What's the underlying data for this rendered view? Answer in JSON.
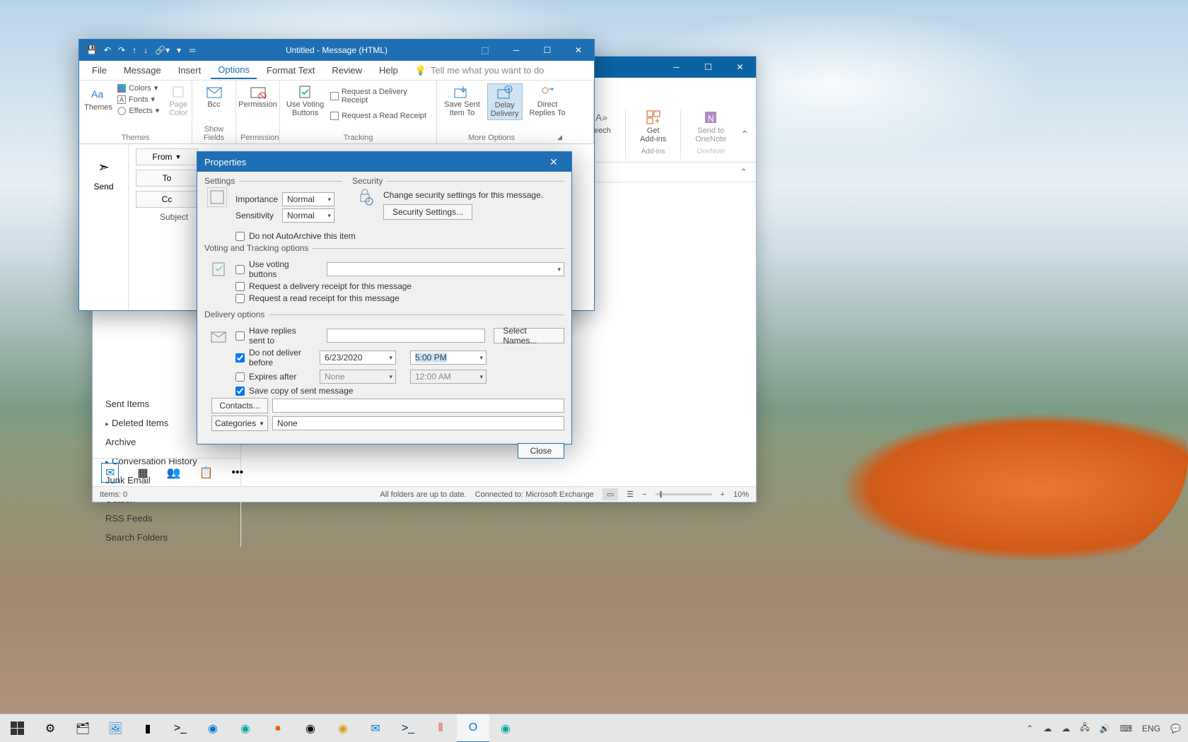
{
  "compose": {
    "title": "Untitled  -  Message (HTML)",
    "menu": {
      "file": "File",
      "message": "Message",
      "insert": "Insert",
      "options": "Options",
      "format_text": "Format Text",
      "review": "Review",
      "help": "Help",
      "tell_me": "Tell me what you want to do"
    },
    "ribbon": {
      "themes": {
        "themes": "Themes",
        "colors": "Colors",
        "fonts": "Fonts",
        "effects": "Effects",
        "page_color": "Page\nColor",
        "group": "Themes"
      },
      "show_fields": {
        "bcc": "Bcc",
        "group": "Show Fields"
      },
      "permission": {
        "permission": "Permission",
        "group": "Permission"
      },
      "tracking": {
        "voting": "Use Voting\nButtons",
        "delivery_receipt": "Request a Delivery Receipt",
        "read_receipt": "Request a Read Receipt",
        "group": "Tracking"
      },
      "more": {
        "save_sent": "Save Sent\nItem To",
        "delay": "Delay\nDelivery",
        "direct": "Direct\nReplies To",
        "group": "More Options"
      }
    },
    "send": "Send",
    "from_btn": "From",
    "to_btn": "To",
    "cc_btn": "Cc",
    "subject_label": "Subject"
  },
  "outlook": {
    "folders": {
      "sent": "Sent Items",
      "deleted": "Deleted Items",
      "archive": "Archive",
      "conversation": "Conversation History",
      "junk": "Junk Email",
      "outbox": "Outbox",
      "rss": "RSS Feeds",
      "search": "Search Folders"
    },
    "ribbon_right": {
      "speech": "peech",
      "addins": "Get\nAdd-ins",
      "onenote": "Send to\nOneNote",
      "addins_grp": "Add-ins",
      "onenote_grp": "OneNote"
    },
    "status": {
      "items": "Items: 0",
      "sync": "All folders are up to date.",
      "connected": "Connected to: Microsoft Exchange",
      "zoom": "10%"
    }
  },
  "dialog": {
    "title": "Properties",
    "settings": {
      "legend": "Settings",
      "importance": "Importance",
      "importance_val": "Normal",
      "sensitivity": "Sensitivity",
      "sensitivity_val": "Normal",
      "no_autoarchive": "Do not AutoArchive this item"
    },
    "security": {
      "legend": "Security",
      "desc": "Change security settings for this message.",
      "btn": "Security Settings..."
    },
    "voting": {
      "legend": "Voting and Tracking options",
      "use_voting": "Use voting buttons",
      "delivery_receipt": "Request a delivery receipt for this message",
      "read_receipt": "Request a read receipt for this message"
    },
    "delivery": {
      "legend": "Delivery options",
      "replies": "Have replies sent to",
      "select_names": "Select Names...",
      "no_deliver_before": "Do not deliver before",
      "date": "6/23/2020",
      "time": "5:00 PM",
      "expires": "Expires after",
      "expires_date": "None",
      "expires_time": "12:00 AM",
      "save_copy": "Save copy of sent message",
      "contacts": "Contacts...",
      "categories": "Categories",
      "categories_val": "None"
    },
    "close": "Close"
  },
  "taskbar": {
    "lang": "ENG"
  }
}
